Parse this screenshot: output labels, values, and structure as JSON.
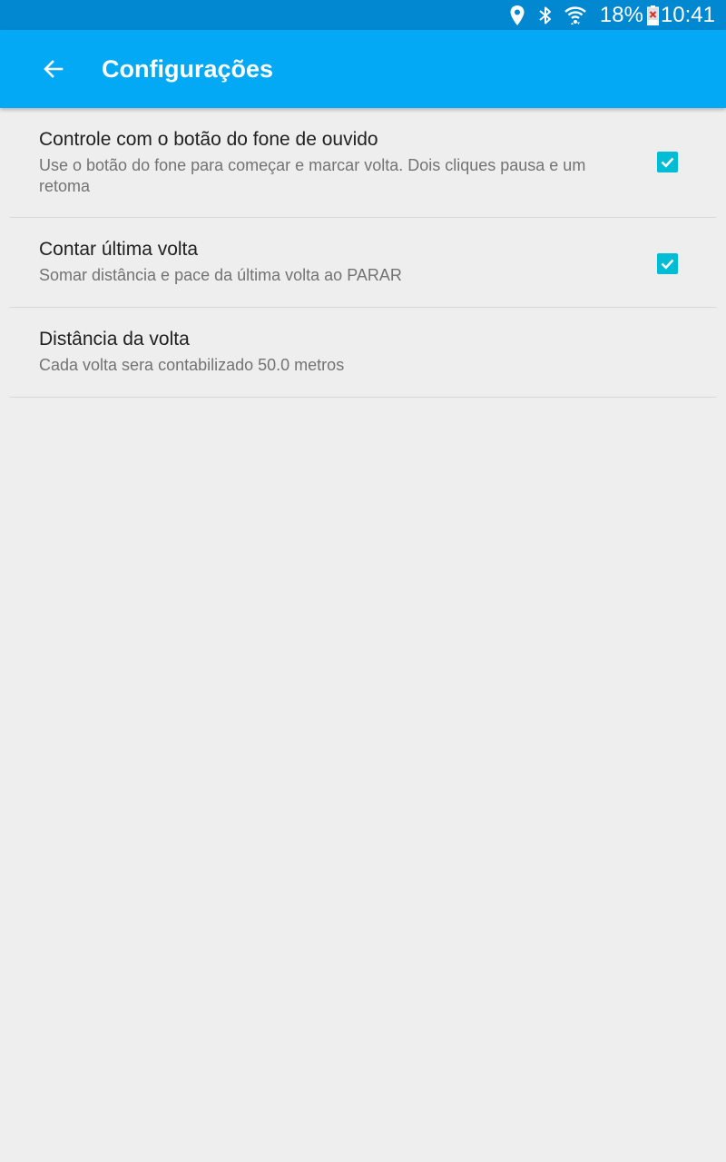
{
  "status_bar": {
    "battery_percent": "18%",
    "time": "10:41",
    "icons": [
      "location-icon",
      "bluetooth-icon",
      "wifi-icon",
      "battery-icon"
    ]
  },
  "app_bar": {
    "title": "Configurações",
    "back_icon": "arrow-back-icon",
    "color": "#03a9f4"
  },
  "preferences": [
    {
      "title": "Controle com o botão do fone de ouvido",
      "summary": "Use o botão do fone para começar e marcar volta. Dois cliques pausa e um retoma",
      "checked": true
    },
    {
      "title": "Contar última volta",
      "summary": "Somar distância e pace da última volta ao PARAR",
      "checked": true
    },
    {
      "title": "Distância da volta",
      "summary": "Cada volta sera contabilizado 50.0 metros"
    }
  ],
  "colors": {
    "status_bar": "#0288d1",
    "accent": "#00bcd4",
    "background": "#eeeeee"
  }
}
